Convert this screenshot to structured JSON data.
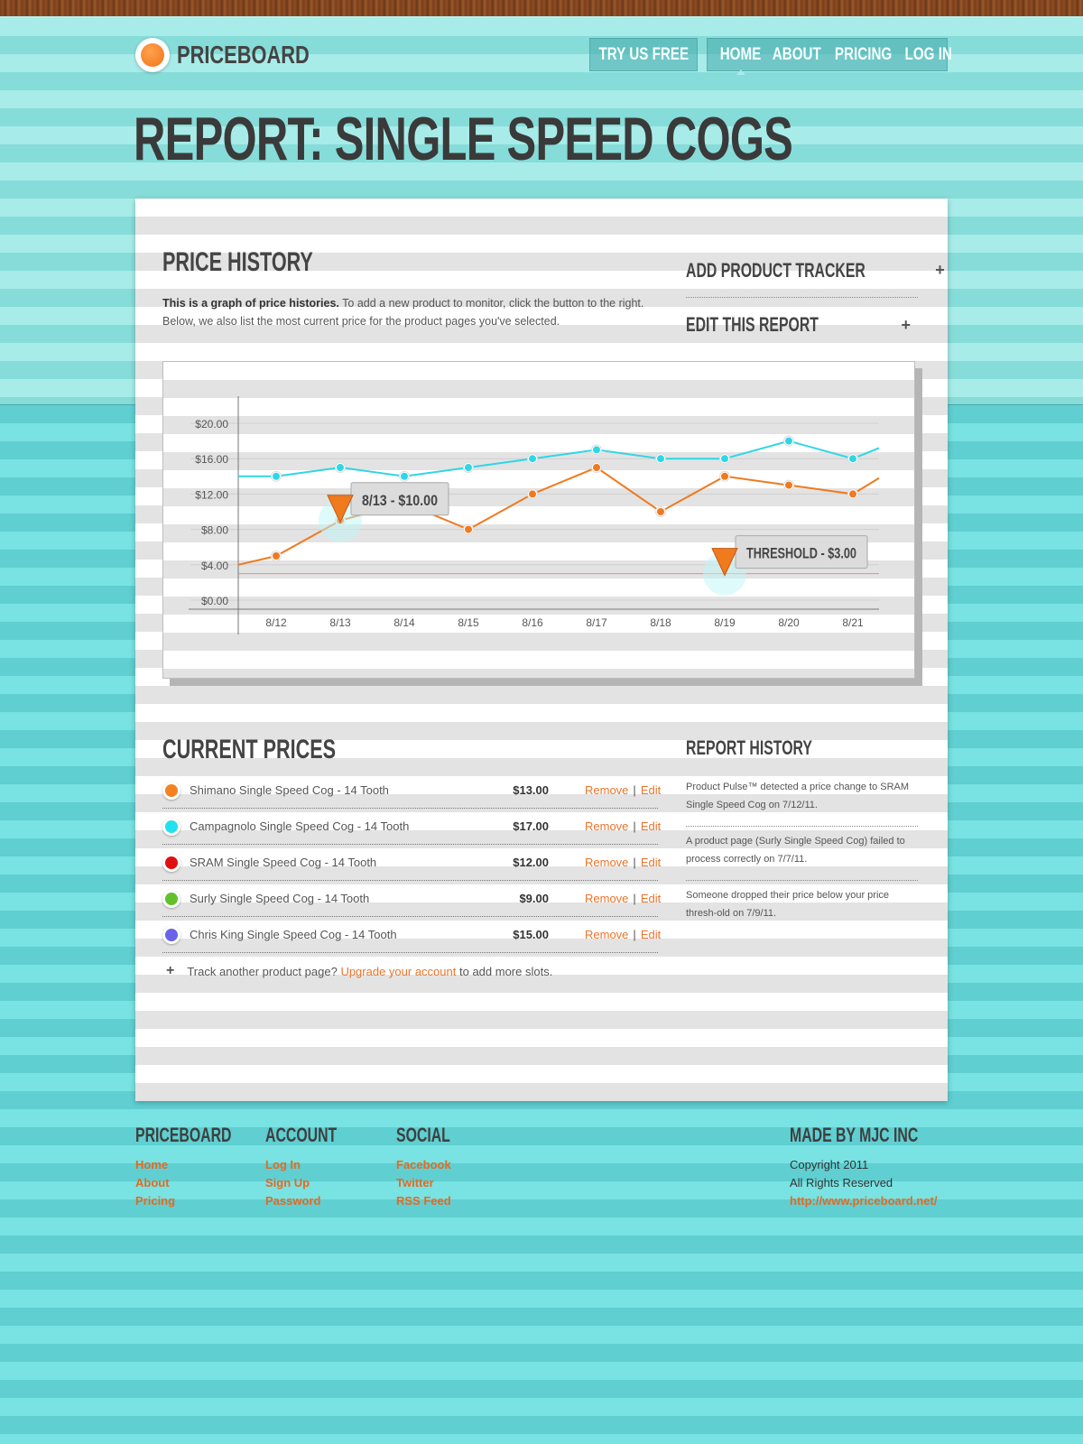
{
  "brand": {
    "name": "PRICEBOARD"
  },
  "header": {
    "try_label": "TRY US FREE",
    "nav": [
      "HOME",
      "ABOUT",
      "PRICING",
      "LOG IN"
    ]
  },
  "page": {
    "title": "REPORT: SINGLE SPEED COGS"
  },
  "price_history": {
    "title": "PRICE HISTORY",
    "desc_bold": "This is a graph of price histories.",
    "desc_rest": " To add a new product to monitor, click the button to the right. Below, we also list the most current price for the product pages you've selected."
  },
  "side_actions": [
    {
      "label": "ADD PRODUCT TRACKER",
      "icon": "plus-icon"
    },
    {
      "label": "EDIT THIS REPORT",
      "icon": "plus-icon"
    }
  ],
  "chart_data": {
    "type": "line",
    "categories": [
      "8/12",
      "8/13",
      "8/14",
      "8/15",
      "8/16",
      "8/17",
      "8/18",
      "8/19",
      "8/20",
      "8/21"
    ],
    "yticks": [
      "$20.00",
      "$16.00",
      "$12.00",
      "$8.00",
      "$4.00",
      "$0.00"
    ],
    "ylim": [
      0,
      20
    ],
    "series": [
      {
        "color": "#2fd6e6",
        "start": 14,
        "values": [
          14,
          15,
          14,
          15,
          16,
          17,
          16,
          16,
          18,
          16
        ],
        "end": 17.2
      },
      {
        "color": "#ef7a20",
        "start": 4,
        "values": [
          5,
          9,
          11,
          8,
          12,
          15,
          10,
          14,
          13,
          12
        ],
        "end": 13.8
      }
    ],
    "threshold": 3,
    "threshold_color": "#e88a8a",
    "callouts": [
      {
        "text": "8/13 - $10.00",
        "x_index": 1,
        "y": 9
      },
      {
        "text": "THRESHOLD - $3.00",
        "x_index": 7,
        "y": 3
      }
    ]
  },
  "current_prices": {
    "title": "CURRENT PRICES",
    "items": [
      {
        "name": "Shimano Single Speed Cog - 14 Tooth",
        "price": "$13.00",
        "color": "#f58220"
      },
      {
        "name": "Campagnolo Single Speed Cog - 14 Tooth",
        "price": "$17.00",
        "color": "#22e0ef"
      },
      {
        "name": "SRAM Single Speed Cog - 14 Tooth",
        "price": "$12.00",
        "color": "#e01010"
      },
      {
        "name": "Surly Single Speed Cog - 14 Tooth",
        "price": "$9.00",
        "color": "#62c12a"
      },
      {
        "name": "Chris King Single Speed Cog - 14 Tooth",
        "price": "$15.00",
        "color": "#6a62e8"
      }
    ],
    "remove_label": "Remove",
    "edit_label": "Edit",
    "add_prefix": "Track another product page?",
    "add_link": "Upgrade your account",
    "add_suffix": "to add more slots."
  },
  "report_history": {
    "title": "REPORT HISTORY",
    "items": [
      "Product Pulse™ detected a price change to SRAM Single Speed Cog on 7/12/11.",
      "A product page (Surly Single Speed Cog) failed to process correctly on 7/7/11.",
      "Someone dropped their price below your price thresh-old on 7/9/11."
    ]
  },
  "footer": {
    "cols": [
      {
        "title": "PRICEBOARD",
        "links": [
          "Home",
          "About",
          "Pricing"
        ]
      },
      {
        "title": "ACCOUNT",
        "links": [
          "Log In",
          "Sign Up",
          "Password"
        ]
      },
      {
        "title": "SOCIAL",
        "links": [
          "Facebook",
          "Twitter",
          "RSS Feed"
        ]
      }
    ],
    "made_by": {
      "title": "MADE BY MJC INC",
      "copyright": "Copyright 2011",
      "rights": "All Rights Reserved",
      "url": "http://www.priceboard.net/"
    }
  }
}
